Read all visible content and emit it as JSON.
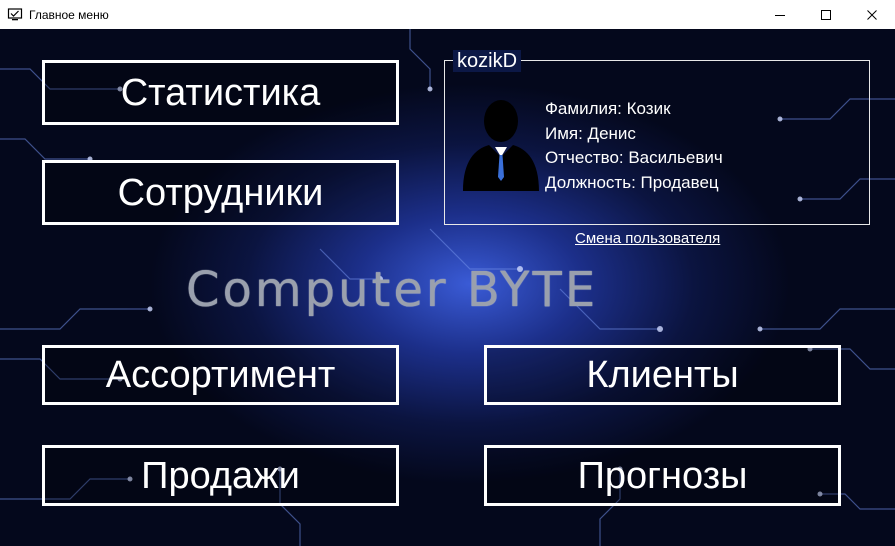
{
  "window": {
    "title": "Главное меню",
    "controls": [
      "minimize",
      "maximize",
      "close"
    ]
  },
  "menu": {
    "statistics": "Статистика",
    "employees": "Сотрудники",
    "assortment": "Ассортимент",
    "sales": "Продажи",
    "clients": "Клиенты",
    "forecasts": "Прогнозы"
  },
  "user": {
    "login": "kozikD",
    "surname": "Фамилия: Козик",
    "name": "Имя: Денис",
    "patronymic": "Отчество: Васильевич",
    "position": "Должность: Продавец",
    "avatar_icon": "user-silhouette-icon"
  },
  "switch_user": "Смена пользователя",
  "brand": "Computer BYTE",
  "colors": {
    "accent": "#ffffff",
    "background_dark": "#04081c",
    "background_glow": "#3a5bd6"
  }
}
